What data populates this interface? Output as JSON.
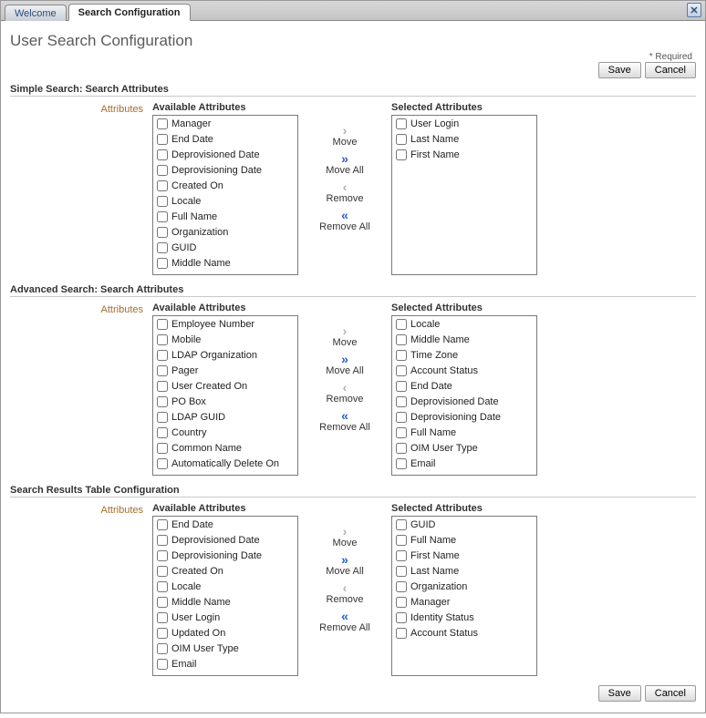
{
  "tabs": {
    "welcome": "Welcome",
    "search_config": "Search Configuration"
  },
  "page_title": "User Search Configuration",
  "required_note": "* Required",
  "buttons": {
    "save": "Save",
    "cancel": "Cancel"
  },
  "shuttle_labels": {
    "move": "Move",
    "move_all": "Move All",
    "remove": "Remove",
    "remove_all": "Remove All"
  },
  "col_available": "Available Attributes",
  "col_selected": "Selected Attributes",
  "attr_label": "Attributes",
  "sections": {
    "simple": {
      "title": "Simple Search: Search Attributes",
      "available": [
        "Manager",
        "End Date",
        "Deprovisioned Date",
        "Deprovisioning Date",
        "Created On",
        "Locale",
        "Full Name",
        "Organization",
        "GUID",
        "Middle Name"
      ],
      "selected": [
        "User Login",
        "Last Name",
        "First Name"
      ]
    },
    "advanced": {
      "title": "Advanced Search: Search Attributes",
      "available": [
        "Employee Number",
        "Mobile",
        "LDAP Organization",
        "Pager",
        "User Created On",
        "PO Box",
        "LDAP GUID",
        "Country",
        "Common Name",
        "Automatically Delete On"
      ],
      "selected": [
        "Locale",
        "Middle Name",
        "Time Zone",
        "Account Status",
        "End Date",
        "Deprovisioned Date",
        "Deprovisioning Date",
        "Full Name",
        "OIM User Type",
        "Email"
      ]
    },
    "results": {
      "title": "Search Results Table Configuration",
      "available": [
        "End Date",
        "Deprovisioned Date",
        "Deprovisioning Date",
        "Created On",
        "Locale",
        "Middle Name",
        "User Login",
        "Updated On",
        "OIM User Type",
        "Email"
      ],
      "selected": [
        "GUID",
        "Full Name",
        "First Name",
        "Last Name",
        "Organization",
        "Manager",
        "Identity Status",
        "Account Status"
      ]
    }
  }
}
